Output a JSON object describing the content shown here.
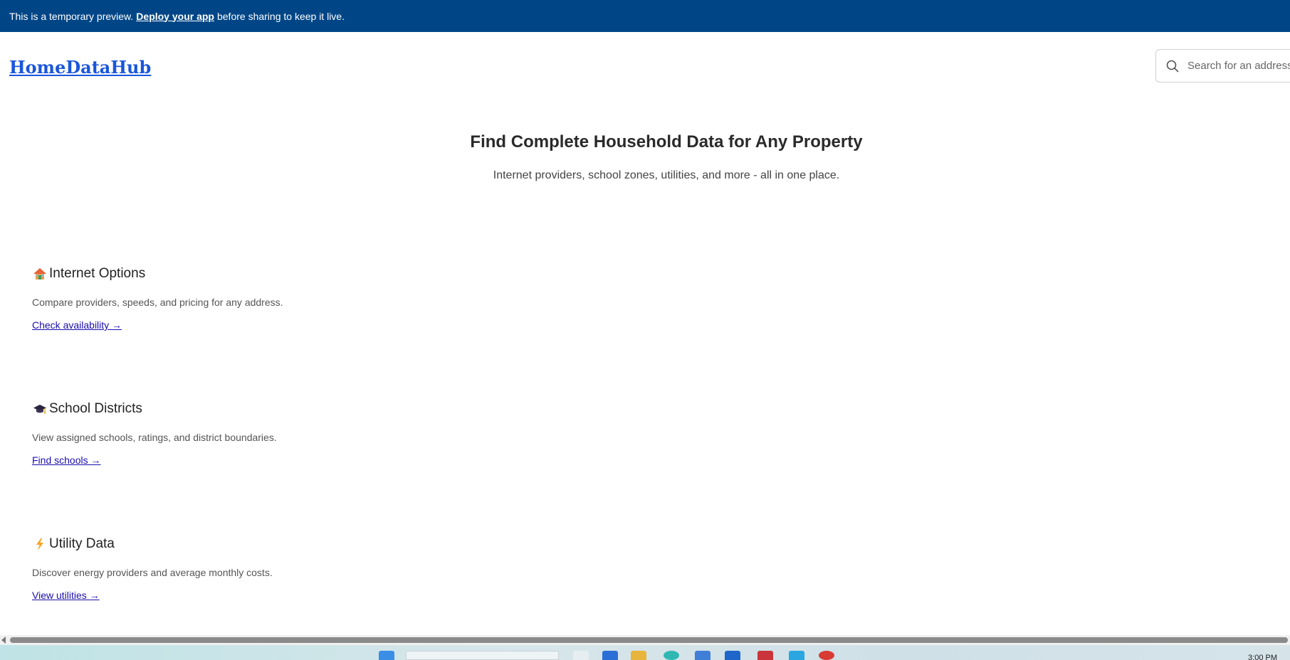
{
  "banner": {
    "prefix": "This is a temporary preview.",
    "link": "Deploy your app",
    "suffix": "before sharing to keep it live."
  },
  "brand": "HomeDataHub",
  "search": {
    "placeholder": "Search for an address, city, or ZIP"
  },
  "hero": {
    "title": "Find Complete Household Data for Any Property",
    "subtitle": "Internet providers, school zones, utilities, and more - all in one place."
  },
  "features": [
    {
      "icon": "house-icon",
      "title": "Internet Options",
      "desc": "Compare providers, speeds, and pricing for any address.",
      "link": "Check availability →"
    },
    {
      "icon": "graduation-cap-icon",
      "title": "School Districts",
      "desc": "View assigned schools, ratings, and district boundaries.",
      "link": "Find schools →"
    },
    {
      "icon": "lightning-icon",
      "title": "Utility Data",
      "desc": "Discover energy providers and average monthly costs.",
      "link": "View utilities →"
    }
  ],
  "taskbar": {
    "clock": "3:00 PM"
  },
  "colors": {
    "banner": "#004687",
    "brand": "#1a56db",
    "link": "#1a0dab"
  }
}
